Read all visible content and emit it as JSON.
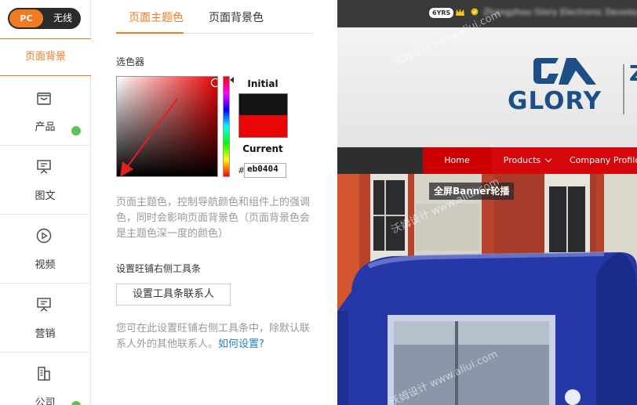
{
  "mode_toggle": {
    "pc": "PC",
    "wireless": "无线"
  },
  "sidebar": {
    "active_label": "页面背景",
    "items": [
      {
        "label": "产品",
        "icon": "shopping-bag-icon"
      },
      {
        "label": "图文",
        "icon": "presentation-icon"
      },
      {
        "label": "视频",
        "icon": "play-icon"
      },
      {
        "label": "营销",
        "icon": "presentation-icon"
      },
      {
        "label": "公司",
        "icon": "building-icon"
      }
    ]
  },
  "panel": {
    "tabs": [
      "页面主题色",
      "页面背景色"
    ],
    "picker_label": "选色器",
    "picker": {
      "initial_label": "Initial",
      "current_label": "Current",
      "hash": "#",
      "hex_value": "eb0404",
      "initial_color": "#141414",
      "current_color": "#eb0404"
    },
    "description": "页面主题色，控制导航颜色和组件上的强调色，同时会影响页面背景色（页面背景色会是主题色深一度的颜色）",
    "toolbar_section_label": "设置旺铺右侧工具条",
    "toolbar_button": "设置工具条联系人",
    "toolbar_desc": "您可在此设置旺铺右侧工具条中，除默认联系人外的其他联系人。",
    "howto_link": "如何设置?"
  },
  "preview": {
    "yrs_badge": "6YRS",
    "company_name": "Zhangzhou Glory Electronic Developm",
    "logo_text": "GLORY",
    "logo_side": "Z",
    "nav": {
      "home": "Home",
      "products": "Products",
      "company": "Company Profile"
    },
    "banner_label": "全屏Banner轮播",
    "watermarks": [
      "沃姆设计 www.aliui.com",
      "沃姆设计 www.aliui.com",
      "沃姆设计 www.aliui.com"
    ]
  },
  "colors": {
    "accent": "#f07b22",
    "theme_red": "#eb0404",
    "link_blue": "#2a7fbe",
    "logo_blue": "#1d4f86",
    "status_green": "#5ac35a"
  }
}
